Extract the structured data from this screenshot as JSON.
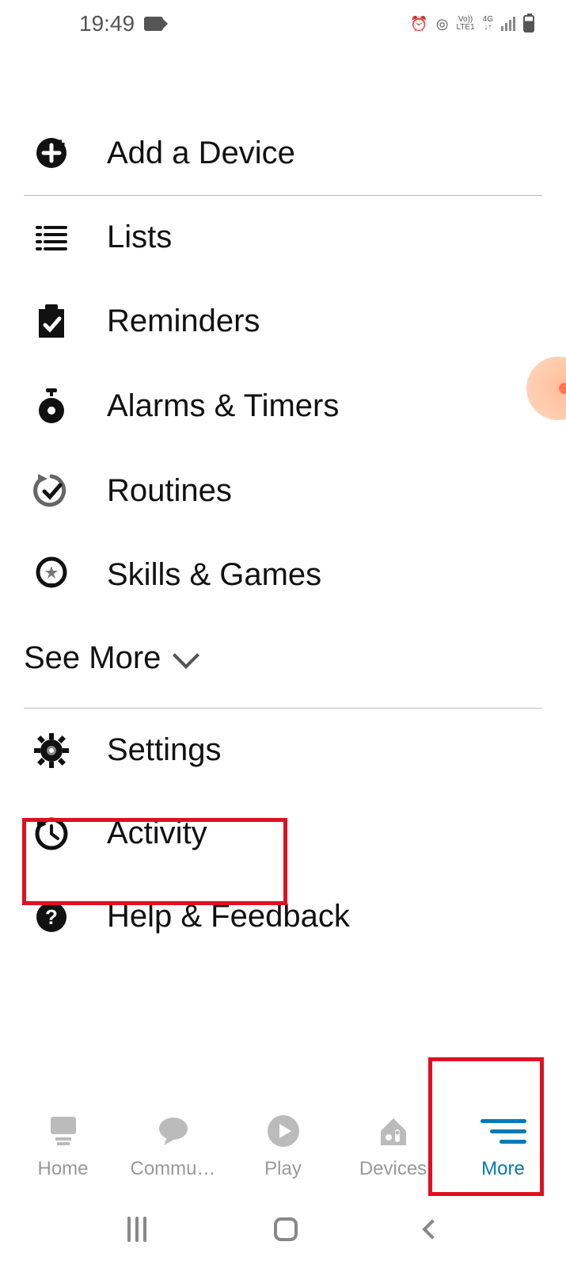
{
  "status": {
    "time": "19:49",
    "lte_top": "Vo))",
    "lte_bottom": "LTE1",
    "net_top": "4G",
    "net_bottom": "↓↑"
  },
  "menu": {
    "add_device": "Add a Device",
    "lists": "Lists",
    "reminders": "Reminders",
    "alarms": "Alarms & Timers",
    "routines": "Routines",
    "skills": "Skills & Games",
    "see_more": "See More",
    "settings": "Settings",
    "activity": "Activity",
    "help": "Help & Feedback"
  },
  "nav": {
    "home": "Home",
    "communicate": "Commu…",
    "play": "Play",
    "devices": "Devices",
    "more": "More"
  }
}
